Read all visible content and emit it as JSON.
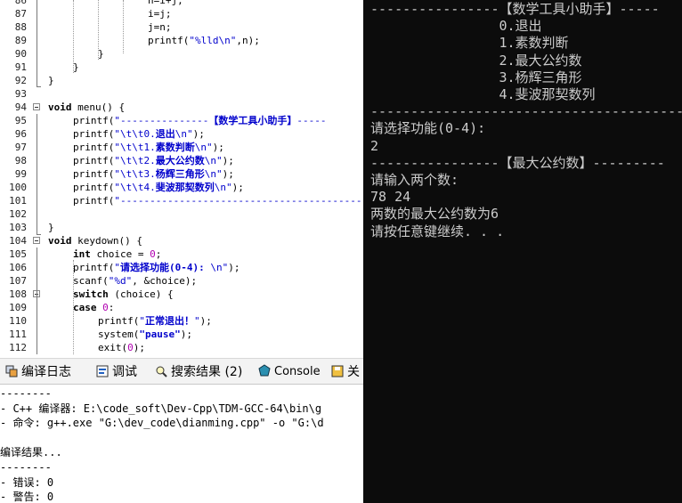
{
  "editor": {
    "lines": [
      {
        "n": "86",
        "parts": [
          [
            "",
            ""
          ]
        ]
      },
      {
        "n": "87",
        "parts": [
          [
            "",
            "i=j;"
          ]
        ]
      },
      {
        "n": "88",
        "parts": [
          [
            "",
            "j=n;"
          ]
        ]
      },
      {
        "n": "89",
        "parts": [
          [
            "",
            "printf("
          ],
          [
            "str",
            "\"%lld\\n\""
          ],
          [
            "",
            ",n);"
          ]
        ]
      },
      {
        "n": "90",
        "parts": [
          [
            "",
            "}"
          ]
        ]
      },
      {
        "n": "91",
        "parts": [
          [
            "",
            "}"
          ]
        ]
      },
      {
        "n": "92",
        "parts": [
          [
            "",
            "}"
          ]
        ]
      },
      {
        "n": "93",
        "parts": []
      },
      {
        "n": "94",
        "parts": [
          [
            "kw",
            "void"
          ],
          [
            "",
            " menu() {"
          ]
        ]
      },
      {
        "n": "95",
        "parts": [
          [
            "",
            "printf("
          ],
          [
            "str",
            "\"---------------"
          ],
          [
            "strb",
            "【数学工具小助手】"
          ],
          [
            "str",
            "-----"
          ]
        ]
      },
      {
        "n": "96",
        "parts": [
          [
            "",
            "printf("
          ],
          [
            "str",
            "\"\\t\\t0."
          ],
          [
            "strb",
            "退出"
          ],
          [
            "str",
            "\\n\""
          ],
          [
            "",
            ");"
          ]
        ]
      },
      {
        "n": "97",
        "parts": [
          [
            "",
            "printf("
          ],
          [
            "str",
            "\"\\t\\t1."
          ],
          [
            "strb",
            "素数判断"
          ],
          [
            "str",
            "\\n\""
          ],
          [
            "",
            ");"
          ]
        ]
      },
      {
        "n": "98",
        "parts": [
          [
            "",
            "printf("
          ],
          [
            "str",
            "\"\\t\\t2."
          ],
          [
            "strb",
            "最大公约数"
          ],
          [
            "str",
            "\\n\""
          ],
          [
            "",
            ");"
          ]
        ]
      },
      {
        "n": "99",
        "parts": [
          [
            "",
            "printf("
          ],
          [
            "str",
            "\"\\t\\t3."
          ],
          [
            "strb",
            "杨辉三角形"
          ],
          [
            "str",
            "\\n\""
          ],
          [
            "",
            ");"
          ]
        ]
      },
      {
        "n": "100",
        "parts": [
          [
            "",
            "printf("
          ],
          [
            "str",
            "\"\\t\\t4."
          ],
          [
            "strb",
            "斐波那契数列"
          ],
          [
            "str",
            "\\n\""
          ],
          [
            "",
            ");"
          ]
        ]
      },
      {
        "n": "101",
        "parts": [
          [
            "",
            "printf("
          ],
          [
            "str",
            "\"--------------------------------------------"
          ]
        ]
      },
      {
        "n": "102",
        "parts": []
      },
      {
        "n": "103",
        "parts": [
          [
            "",
            "}"
          ]
        ]
      },
      {
        "n": "104",
        "parts": [
          [
            "kw",
            "void"
          ],
          [
            "",
            " keydown() {"
          ]
        ]
      },
      {
        "n": "105",
        "parts": [
          [
            "kw",
            "int"
          ],
          [
            "",
            " choice = "
          ],
          [
            "num",
            "0"
          ],
          [
            "",
            ";"
          ]
        ]
      },
      {
        "n": "106",
        "parts": [
          [
            "",
            "printf("
          ],
          [
            "str",
            "\""
          ],
          [
            "strb",
            "请选择功能(0-4): "
          ],
          [
            "str",
            "\\n\""
          ],
          [
            "",
            ");"
          ]
        ]
      },
      {
        "n": "107",
        "parts": [
          [
            "",
            "scanf("
          ],
          [
            "str",
            "\"%d\""
          ],
          [
            "",
            ", &choice);"
          ]
        ]
      },
      {
        "n": "108",
        "parts": [
          [
            "kw",
            "switch"
          ],
          [
            "",
            " (choice) {"
          ]
        ]
      },
      {
        "n": "109",
        "parts": [
          [
            "kw",
            "case"
          ],
          [
            "",
            " "
          ],
          [
            "num",
            "0"
          ],
          [
            "",
            ":"
          ]
        ]
      },
      {
        "n": "110",
        "parts": [
          [
            "",
            "printf("
          ],
          [
            "str",
            "\""
          ],
          [
            "strb",
            "正常退出！"
          ],
          [
            "str",
            "\""
          ],
          [
            "",
            ");"
          ]
        ]
      },
      {
        "n": "111",
        "parts": [
          [
            "",
            "system("
          ],
          [
            "strb",
            "\"pause\""
          ],
          [
            "",
            ");"
          ]
        ]
      },
      {
        "n": "112",
        "parts": [
          [
            "",
            "exit("
          ],
          [
            "num",
            "0"
          ],
          [
            "",
            ");"
          ]
        ]
      }
    ],
    "line86_text": "n=i+j;"
  },
  "tabs": [
    {
      "label": "编译日志",
      "icon": "compile-log-icon"
    },
    {
      "label": "调试",
      "icon": "debug-icon"
    },
    {
      "label": "搜索结果 (2)",
      "icon": "search-results-icon"
    },
    {
      "label": "Console",
      "icon": "console-icon"
    },
    {
      "label": "关",
      "icon": "close-tab-icon"
    }
  ],
  "log": [
    "--------",
    "- C++ 编译器: E:\\code_soft\\Dev-Cpp\\TDM-GCC-64\\bin\\g",
    "- 命令: g++.exe \"G:\\dev_code\\dianming.cpp\" -o \"G:\\d",
    "",
    "编译结果...",
    "--------",
    "- 错误: 0",
    "- 警告: 0"
  ],
  "console": [
    "----------------【数学工具小助手】-----",
    "                0.退出",
    "                1.素数判断",
    "                2.最大公约数",
    "                3.杨辉三角形",
    "                4.斐波那契数列",
    "----------------------------------------",
    "请选择功能(0-4):",
    "2",
    "----------------【最大公约数】---------",
    "请输入两个数:",
    "78 24",
    "两数的最大公约数为6",
    "请按任意键继续. . ."
  ],
  "colors": {
    "console_bg": "#0c0c0c",
    "console_text": "#cccccc",
    "string": "#0000cc",
    "number": "#b000b0"
  }
}
